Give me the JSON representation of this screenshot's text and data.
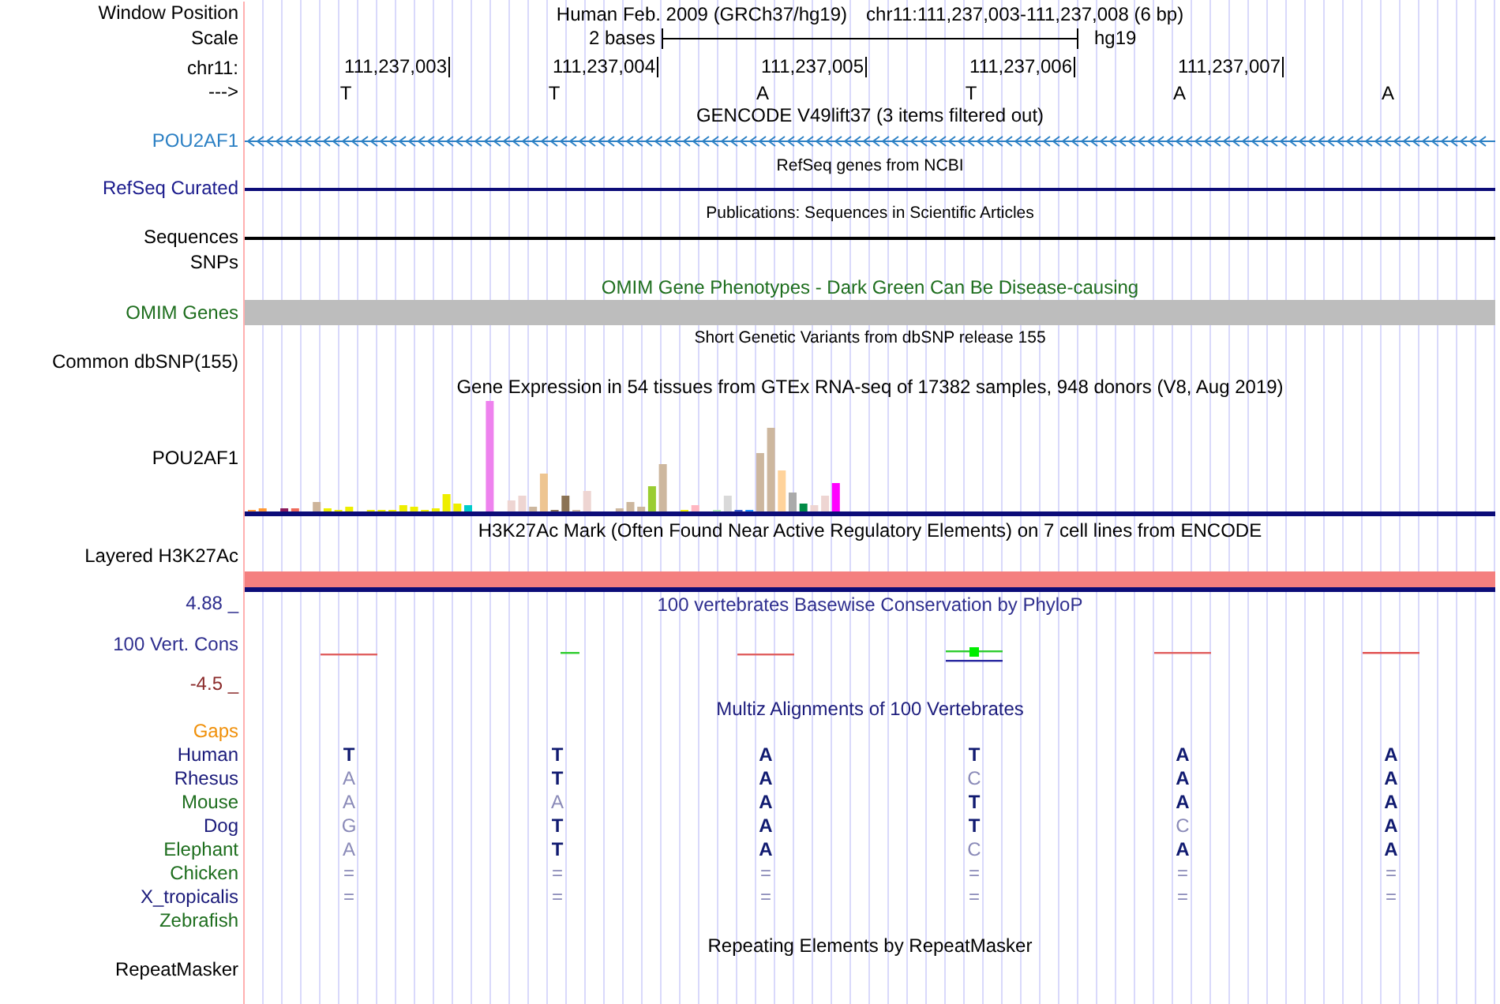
{
  "header": {
    "position_label": "Window Position",
    "assembly": "Human Feb. 2009 (GRCh37/hg19)",
    "range": "chr11:111,237,003-111,237,008 (6 bp)",
    "scale_label": "Scale",
    "scale_text": "2 bases",
    "db": "hg19",
    "chrom_label": "chr11:",
    "ticks": [
      "111,237,003",
      "111,237,004",
      "111,237,005",
      "111,237,006",
      "111,237,007"
    ],
    "strand_label": "--->",
    "bases": [
      "T",
      "T",
      "A",
      "T",
      "A",
      "A"
    ]
  },
  "tracks": [
    {
      "kind": "gene",
      "title": "GENCODE V49lift37 (3 items filtered out)",
      "label": "POU2AF1",
      "color": "#2c80c4"
    },
    {
      "kind": "line",
      "title": "RefSeq genes from NCBI",
      "label": "RefSeq Curated",
      "color": "#1a1a8c"
    },
    {
      "kind": "line",
      "title": "Publications: Sequences in Scientific Articles",
      "label": "Sequences",
      "color": "#000000"
    },
    {
      "kind": "empty",
      "label": "SNPs",
      "color": "#000000"
    },
    {
      "kind": "bar",
      "title": "OMIM Gene Phenotypes - Dark Green Can Be Disease-causing",
      "label": "OMIM Genes",
      "color": "#1e6e1e"
    },
    {
      "kind": "variants",
      "title": "Short Genetic Variants from dbSNP release 155",
      "label": "Common dbSNP(155)",
      "color": "#000000"
    },
    {
      "kind": "expression",
      "title": "Gene Expression in 54 tissues from GTEx RNA-seq of 17382 samples, 948 donors (V8, Aug 2019)",
      "label": "POU2AF1",
      "color": "#000000"
    },
    {
      "kind": "signal",
      "title": "H3K27Ac Mark (Often Found Near Active Regulatory Elements) on 7 cell lines from ENCODE",
      "label": "Layered H3K27Ac",
      "color": "#000000"
    },
    {
      "kind": "conservation",
      "title": "100 vertebrates Basewise Conservation by PhyloP",
      "label": "100 Vert. Cons",
      "color": "#2e2e8e",
      "max": "4.88 _",
      "min": "-4.5 _"
    },
    {
      "kind": "alignment",
      "title": "Multiz Alignments of 100 Vertebrates",
      "label": "Gaps",
      "color": "#f0900a",
      "species": [
        {
          "name": "Human",
          "color": "#1a1a7a",
          "bases": [
            {
              "text": "T",
              "match": true
            },
            {
              "text": "T",
              "match": true
            },
            {
              "text": "A",
              "match": true
            },
            {
              "text": "T",
              "match": true
            },
            {
              "text": "A",
              "match": true
            },
            {
              "text": "A",
              "match": true
            }
          ]
        },
        {
          "name": "Rhesus",
          "color": "#1a1a7a",
          "bases": [
            {
              "text": "A",
              "match": false
            },
            {
              "text": "T",
              "match": true
            },
            {
              "text": "A",
              "match": true
            },
            {
              "text": "C",
              "match": false
            },
            {
              "text": "A",
              "match": true
            },
            {
              "text": "A",
              "match": true
            }
          ]
        },
        {
          "name": "Mouse",
          "color": "#1e6e1e",
          "bases": [
            {
              "text": "A",
              "match": false
            },
            {
              "text": "A",
              "match": false
            },
            {
              "text": "A",
              "match": true
            },
            {
              "text": "T",
              "match": true
            },
            {
              "text": "A",
              "match": true
            },
            {
              "text": "A",
              "match": true
            }
          ]
        },
        {
          "name": "Dog",
          "color": "#1a1a7a",
          "bases": [
            {
              "text": "G",
              "match": false
            },
            {
              "text": "T",
              "match": true
            },
            {
              "text": "A",
              "match": true
            },
            {
              "text": "T",
              "match": true
            },
            {
              "text": "C",
              "match": false
            },
            {
              "text": "A",
              "match": true
            }
          ]
        },
        {
          "name": "Elephant",
          "color": "#1e6e1e",
          "bases": [
            {
              "text": "A",
              "match": false
            },
            {
              "text": "T",
              "match": true
            },
            {
              "text": "A",
              "match": true
            },
            {
              "text": "C",
              "match": false
            },
            {
              "text": "A",
              "match": true
            },
            {
              "text": "A",
              "match": true
            }
          ]
        },
        {
          "name": "Chicken",
          "color": "#1e6e1e",
          "bases": [
            {
              "text": "=",
              "match": false
            },
            {
              "text": "=",
              "match": false
            },
            {
              "text": "=",
              "match": false
            },
            {
              "text": "=",
              "match": false
            },
            {
              "text": "=",
              "match": false
            },
            {
              "text": "=",
              "match": false
            }
          ]
        },
        {
          "name": "X_tropicalis",
          "color": "#1a1a7a",
          "bases": [
            {
              "text": "=",
              "match": false
            },
            {
              "text": "=",
              "match": false
            },
            {
              "text": "=",
              "match": false
            },
            {
              "text": "=",
              "match": false
            },
            {
              "text": "=",
              "match": false
            },
            {
              "text": "=",
              "match": false
            }
          ]
        },
        {
          "name": "Zebrafish",
          "color": "#1e6e1e"
        }
      ]
    },
    {
      "kind": "empty",
      "title": "Repeating Elements by RepeatMasker",
      "label": "RepeatMasker",
      "color": "#000000"
    }
  ]
}
